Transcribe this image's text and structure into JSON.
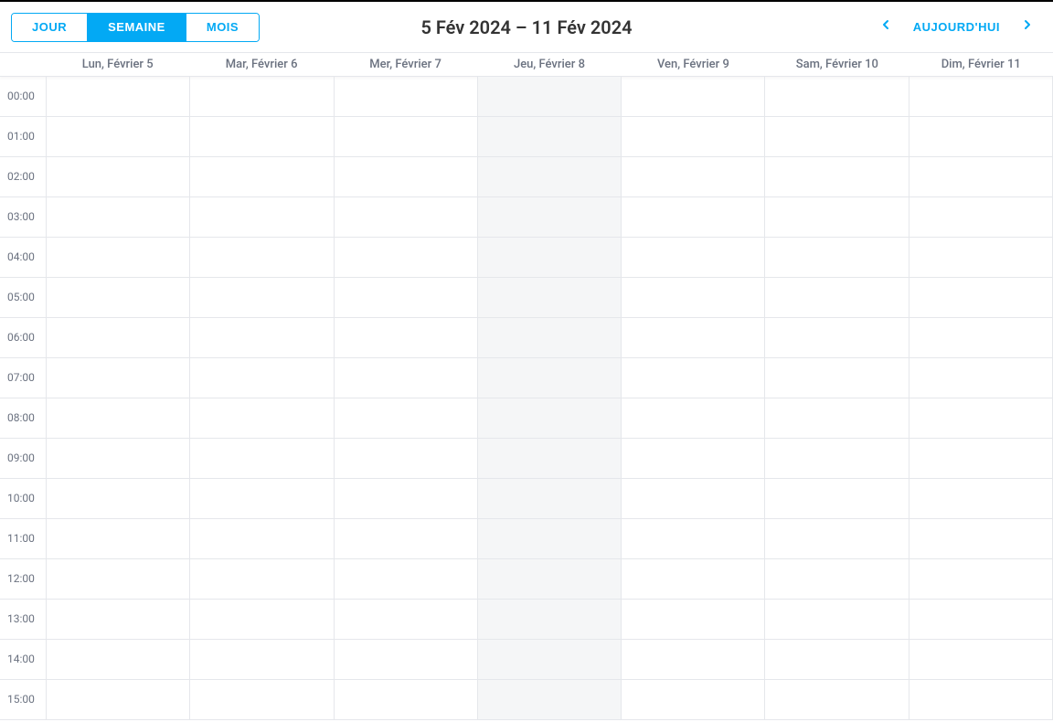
{
  "toolbar": {
    "views": {
      "day": "JOUR",
      "week": "SEMAINE",
      "month": "MOIS",
      "active": "week"
    },
    "title": "5 Fév 2024 – 11 Fév 2024",
    "today": "AUJOURD'HUI"
  },
  "days": [
    {
      "label": "Lun, Février 5",
      "is_today": false
    },
    {
      "label": "Mar, Février 6",
      "is_today": false
    },
    {
      "label": "Mer, Février 7",
      "is_today": false
    },
    {
      "label": "Jeu, Février 8",
      "is_today": true
    },
    {
      "label": "Ven, Février 9",
      "is_today": false
    },
    {
      "label": "Sam, Février 10",
      "is_today": false
    },
    {
      "label": "Dim, Février 11",
      "is_today": false
    }
  ],
  "hours": [
    "00:00",
    "01:00",
    "02:00",
    "03:00",
    "04:00",
    "05:00",
    "06:00",
    "07:00",
    "08:00",
    "09:00",
    "10:00",
    "11:00",
    "12:00",
    "13:00",
    "14:00",
    "15:00"
  ],
  "colors": {
    "accent": "#03a9f4",
    "border": "#e5e7eb",
    "muted_text": "#6b7280",
    "today_bg": "#f5f6f7"
  }
}
